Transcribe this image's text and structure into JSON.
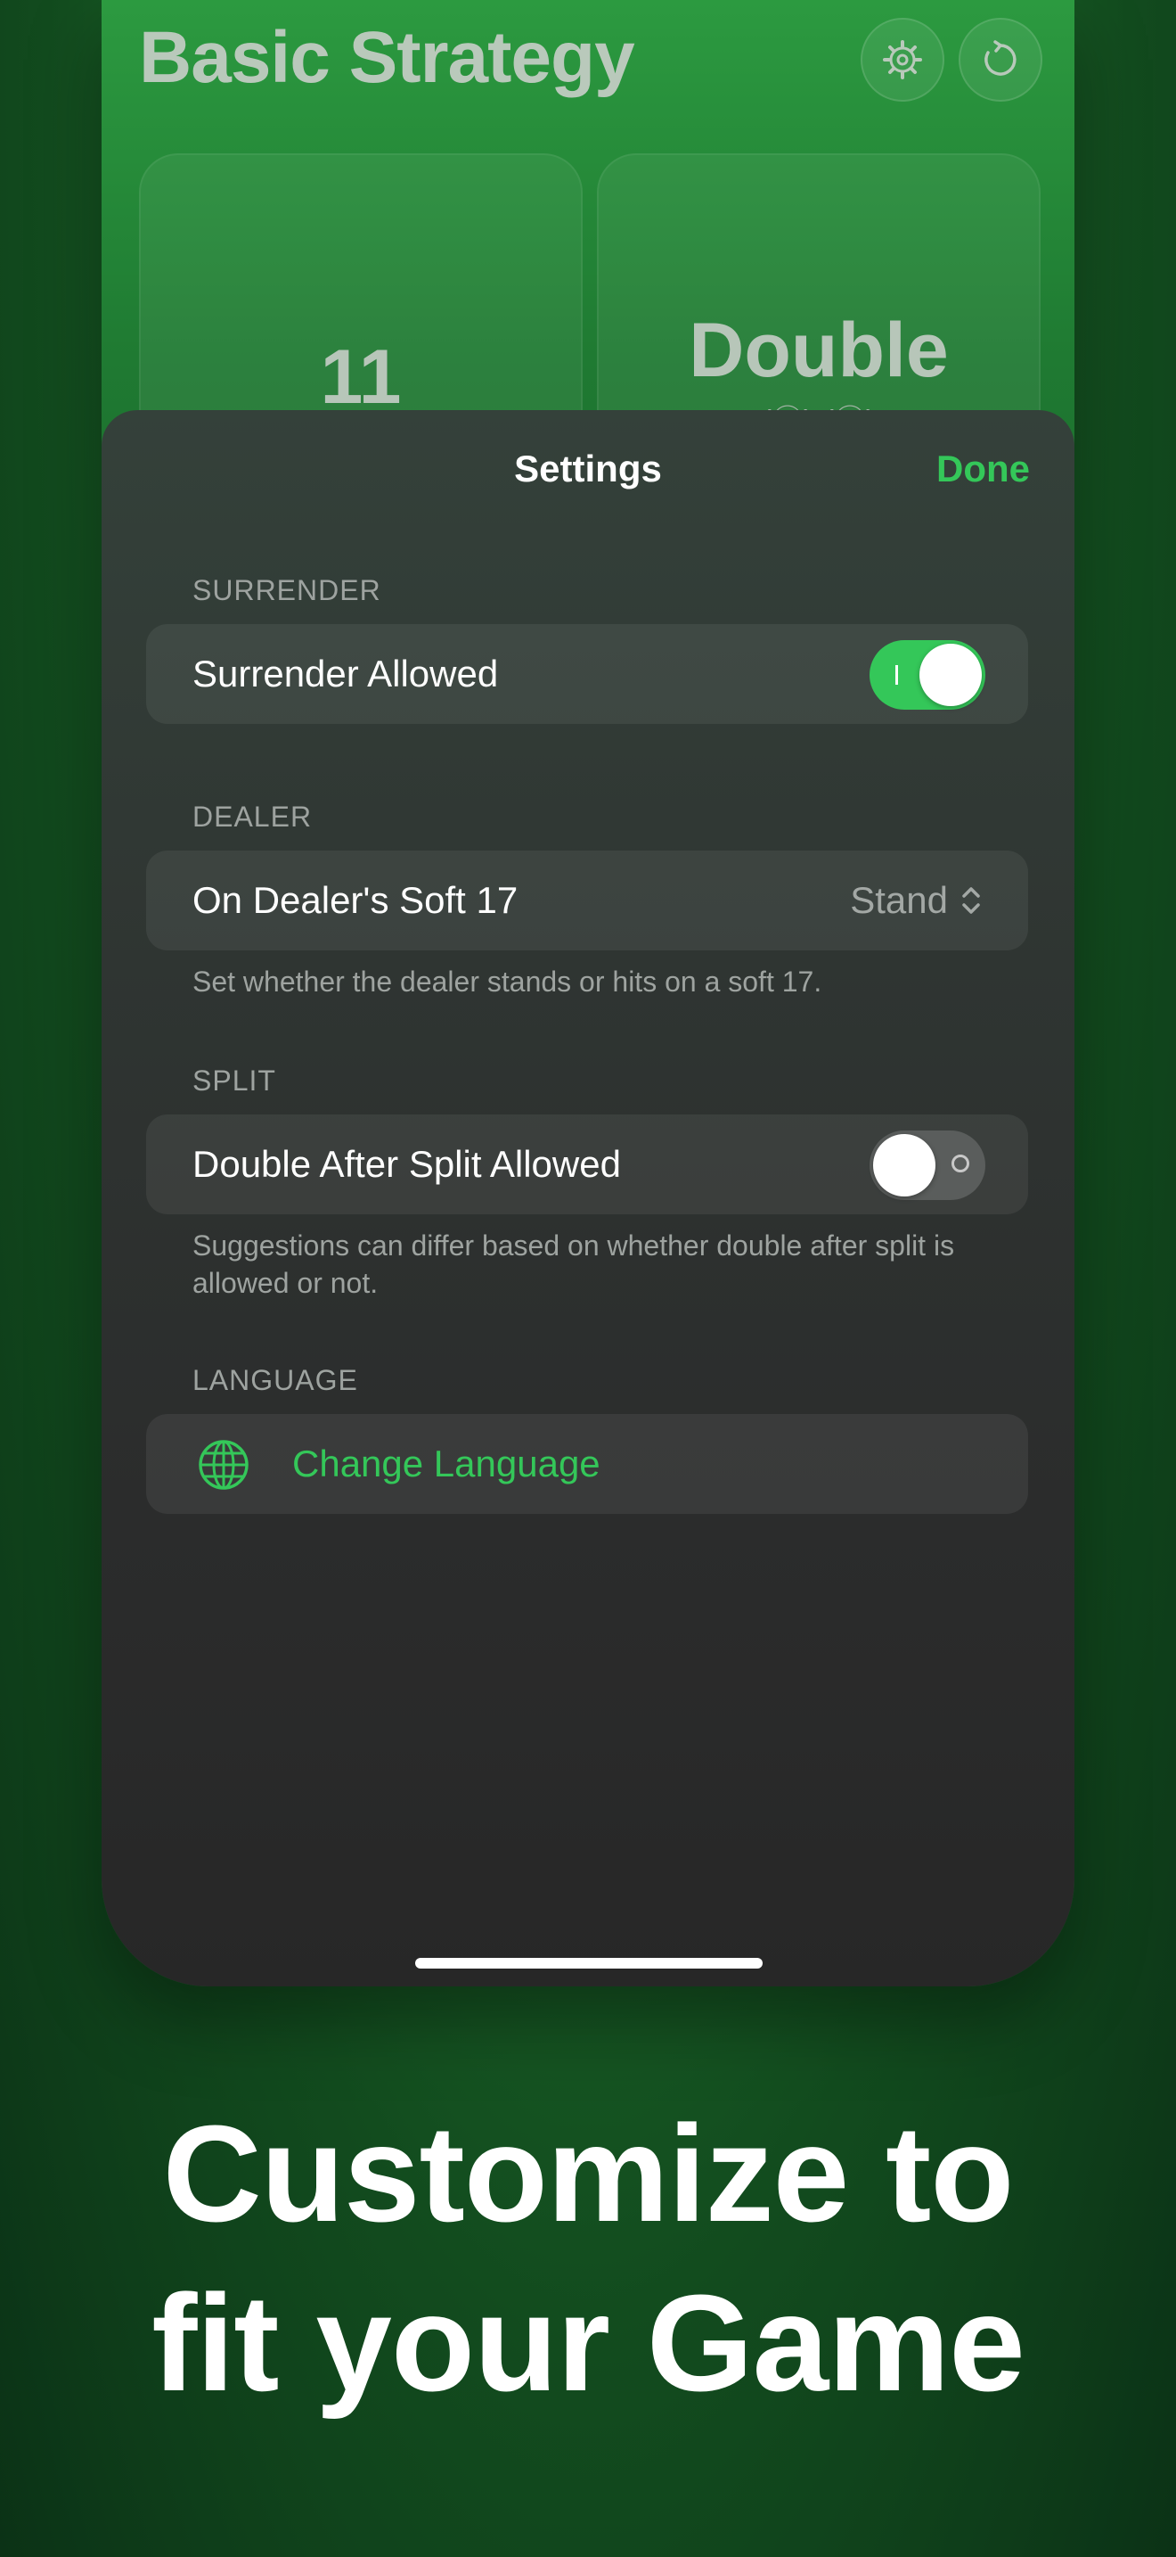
{
  "app": {
    "title": "Basic Strategy",
    "left_card": {
      "value": "11"
    },
    "right_card": {
      "action": "Double",
      "subtitle": "(Ⓓ) (Ⓗ)"
    }
  },
  "settings": {
    "title": "Settings",
    "done_label": "Done",
    "surrender": {
      "header": "SURRENDER",
      "label": "Surrender Allowed",
      "enabled": true
    },
    "dealer": {
      "header": "DEALER",
      "label": "On Dealer's Soft 17",
      "value": "Stand",
      "footer": "Set whether the dealer stands or hits on a soft 17."
    },
    "split": {
      "header": "SPLIT",
      "label": "Double After Split Allowed",
      "enabled": false,
      "footer": "Suggestions can differ based on whether double after split is allowed or not."
    },
    "language": {
      "header": "LANGUAGE",
      "label": "Change Language",
      "icon": "globe-icon"
    }
  },
  "tagline": {
    "line1": "Customize to",
    "line2": "fit your Game"
  },
  "colors": {
    "accent": "#34c759"
  }
}
